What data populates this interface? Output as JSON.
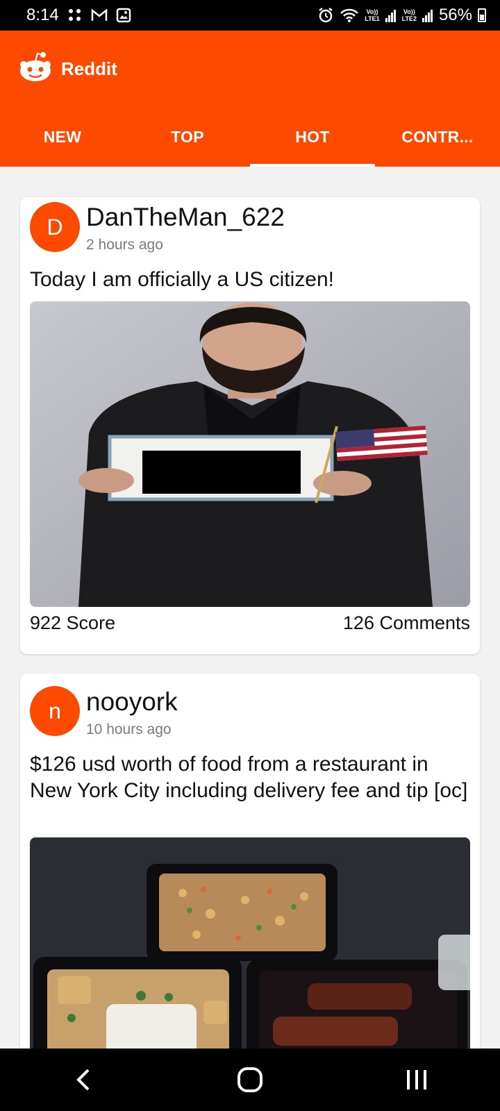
{
  "status_bar": {
    "time": "8:14",
    "battery": "56%",
    "lte1": "LTE1",
    "lte2": "LTE2",
    "volte": "Vo))"
  },
  "app": {
    "title": "Reddit",
    "accent": "#fc4a00"
  },
  "tabs": [
    {
      "label": "NEW",
      "active": false
    },
    {
      "label": "TOP",
      "active": false
    },
    {
      "label": "HOT",
      "active": true
    },
    {
      "label": "CONTR...",
      "active": false
    }
  ],
  "posts": [
    {
      "avatar_letter": "D",
      "username": "DanTheMan_622",
      "time_ago": "2 hours ago",
      "title": "Today I am officially a US citizen!",
      "score": "922 Score",
      "comments": "126 Comments"
    },
    {
      "avatar_letter": "n",
      "username": "nooyork",
      "time_ago": "10 hours ago",
      "title": "$126 usd worth of food from a restaurant in New York City including delivery fee and tip [oc]"
    }
  ]
}
